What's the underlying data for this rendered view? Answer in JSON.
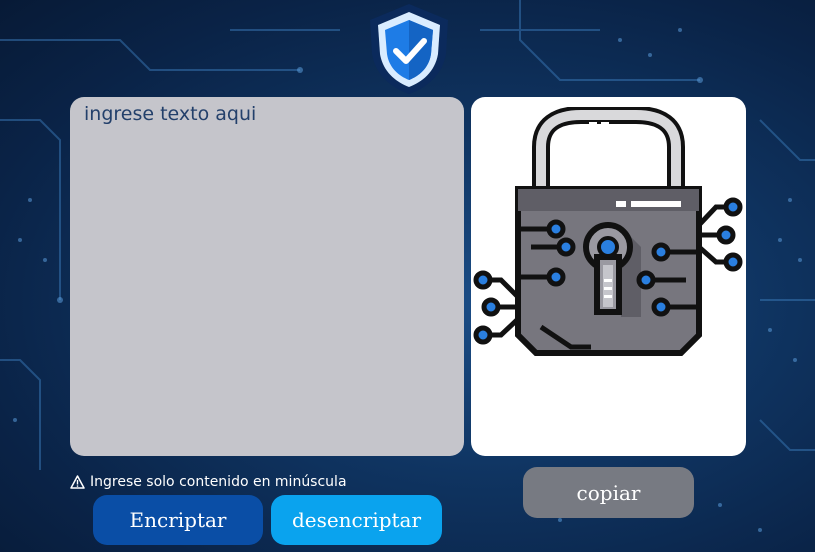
{
  "input": {
    "placeholder": "ingrese texto aqui"
  },
  "warning": {
    "icon": "warning-icon",
    "text": "Ingrese solo contenido en minúscula"
  },
  "buttons": {
    "encrypt": "Encriptar",
    "decrypt": "desencriptar",
    "copy": "copiar"
  },
  "colors": {
    "background": "#0a2347",
    "textarea": "#c5c5cb",
    "text": "#23406b",
    "encrypt": "#0a4ea6",
    "decrypt": "#0aa3ee",
    "copy": "#777a82",
    "shield": "#1e7ce6"
  },
  "icons": {
    "logo": "shield-check-icon",
    "illustration": "padlock-circuit-icon"
  }
}
